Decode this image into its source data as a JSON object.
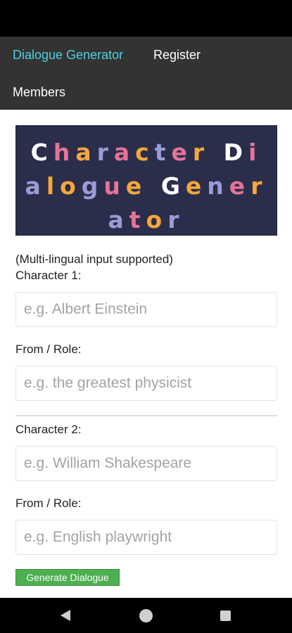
{
  "nav": {
    "dialogue_generator": "Dialogue Generator",
    "register": "Register",
    "members": "Members",
    "active_color": "#4dd0e1"
  },
  "banner": {
    "lines": [
      "Character Di",
      "alogue Gener",
      "ator"
    ],
    "background": "#2b2e4a",
    "letter_colors": {
      "line1": [
        "#ffffff",
        "#e57399",
        "#f5a73d",
        "#9b9bd6",
        "#e57399",
        "#f5a73d",
        "#9b9bd6",
        "#e57399",
        "#f5a73d",
        " ",
        "#ffffff",
        "#e57399"
      ],
      "line2": [
        "#9b9bd6",
        "#f5a73d",
        "#f5a73d",
        "#9b9bd6",
        "#e57399",
        "#f5a73d",
        " ",
        "#ffffff",
        "#f5a73d",
        "#9b9bd6",
        "#e57399",
        "#f5a73d"
      ],
      "line3": [
        "#9b9bd6",
        "#e57399",
        "#f5a73d",
        "#9b9bd6"
      ]
    }
  },
  "form": {
    "note": "(Multi-lingual input supported)",
    "character1_label": "Character 1:",
    "character1_placeholder": "e.g. Albert Einstein",
    "role1_label": "From / Role:",
    "role1_placeholder": "e.g. the greatest physicist",
    "character2_label": "Character 2:",
    "character2_placeholder": "e.g. William Shakespeare",
    "role2_label": "From / Role:",
    "role2_placeholder": "e.g. English playwright",
    "generate_button": "Generate Dialogue"
  },
  "system_nav": {
    "back": "back-icon",
    "home": "home-icon",
    "recents": "recents-icon"
  }
}
